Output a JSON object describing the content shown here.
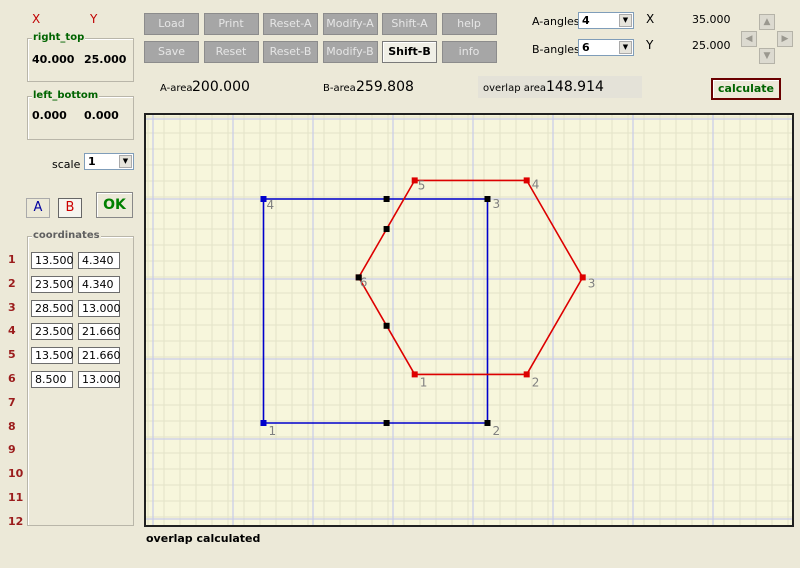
{
  "header": {
    "x_label": "X",
    "y_label": "Y"
  },
  "right_top": {
    "label": "right_top",
    "x": "40.000",
    "y": "25.000"
  },
  "left_bottom": {
    "label": "left_bottom",
    "x": "0.000",
    "y": "0.000"
  },
  "scale": {
    "label": "scale",
    "value": "1"
  },
  "shape_buttons": {
    "a": "A",
    "b": "B",
    "ok": "OK"
  },
  "coordinates": {
    "label": "coordinates",
    "rows": [
      {
        "n": "1",
        "x": "13.500",
        "y": "4.340"
      },
      {
        "n": "2",
        "x": "23.500",
        "y": "4.340"
      },
      {
        "n": "3",
        "x": "28.500",
        "y": "13.000"
      },
      {
        "n": "4",
        "x": "23.500",
        "y": "21.660"
      },
      {
        "n": "5",
        "x": "13.500",
        "y": "21.660"
      },
      {
        "n": "6",
        "x": "8.500",
        "y": "13.000"
      },
      {
        "n": "7",
        "x": "",
        "y": ""
      },
      {
        "n": "8",
        "x": "",
        "y": ""
      },
      {
        "n": "9",
        "x": "",
        "y": ""
      },
      {
        "n": "10",
        "x": "",
        "y": ""
      },
      {
        "n": "11",
        "x": "",
        "y": ""
      },
      {
        "n": "12",
        "x": "",
        "y": ""
      }
    ]
  },
  "toolbar": {
    "row1": [
      "Load",
      "Print",
      "Reset-A",
      "Modify-A",
      "Shift-A",
      "help"
    ],
    "row2": [
      "Save",
      "Reset",
      "Reset-B",
      "Modify-B",
      "Shift-B",
      "info"
    ],
    "active": "Shift-B"
  },
  "angles": {
    "a_label": "A-angles",
    "a_value": "4",
    "b_label": "B-angles",
    "b_value": "6"
  },
  "coords_readout": {
    "x_label": "X",
    "x_value": "35.000",
    "y_label": "Y",
    "y_value": "25.000"
  },
  "areas": {
    "a_label": "A-area",
    "a_value": "200.000",
    "b_label": "B-area",
    "b_value": "259.808",
    "overlap_label": "overlap area",
    "overlap_value": "148.914"
  },
  "calculate_label": "calculate",
  "status": "overlap calculated",
  "colors": {
    "shape_a": "#0000cc",
    "shape_b": "#dd0000",
    "overlap_points": "#000000",
    "grid_major": "#c8cbe8",
    "grid_minor": "#e3e3c8"
  },
  "plot": {
    "polygon_a": {
      "labels": [
        "1",
        "2",
        "3",
        "4"
      ],
      "points": [
        [
          0,
          0
        ],
        [
          20,
          0
        ],
        [
          20,
          20
        ],
        [
          0,
          20
        ]
      ]
    },
    "polygon_b": {
      "labels": [
        "1",
        "2",
        "3",
        "4",
        "5",
        "6"
      ],
      "points": [
        [
          13.5,
          4.34
        ],
        [
          23.5,
          4.34
        ],
        [
          28.5,
          13.0
        ],
        [
          23.5,
          21.66
        ],
        [
          13.5,
          21.66
        ],
        [
          8.5,
          13.0
        ]
      ]
    },
    "overlap_points": [
      [
        8.5,
        13.0
      ],
      [
        10.99,
        17.32
      ],
      [
        10.99,
        8.68
      ]
    ]
  }
}
